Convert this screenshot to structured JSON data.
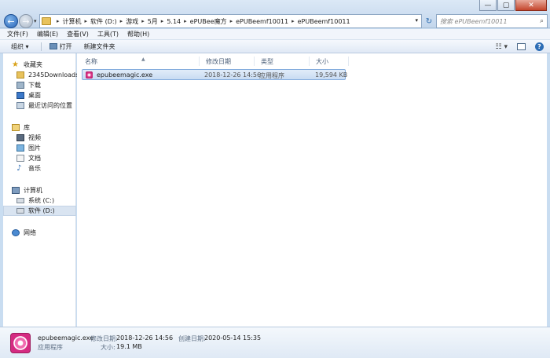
{
  "window": {
    "minimize": "—",
    "maximize": "▢",
    "close": "✕"
  },
  "nav": {
    "back_glyph": "←",
    "forward_glyph": "→"
  },
  "address": {
    "crumbs": [
      "计算机",
      "软件 (D:)",
      "游戏",
      "5月",
      "5.14",
      "ePUBee魔方",
      "ePUBeemf10011",
      "ePUBeemf10011"
    ]
  },
  "search": {
    "placeholder": "搜索 ePUBeemf10011"
  },
  "menu": {
    "items": [
      "文件(F)",
      "编辑(E)",
      "查看(V)",
      "工具(T)",
      "帮助(H)"
    ]
  },
  "toolbar": {
    "organize": "组织 ▾",
    "open": "打开",
    "new_folder": "新建文件夹"
  },
  "sidebar": {
    "favorites": "收藏夹",
    "fav_items": [
      "2345Downloads",
      "下载",
      "桌面",
      "最近访问的位置"
    ],
    "library": "库",
    "lib_items": [
      "视频",
      "图片",
      "文档",
      "音乐"
    ],
    "computer": "计算机",
    "drives": [
      "系统 (C:)",
      "软件 (D:)"
    ],
    "network": "网络"
  },
  "columns": {
    "name": "名称",
    "modified": "修改日期",
    "type": "类型",
    "size": "大小"
  },
  "files": [
    {
      "name": "epubeemagic.exe",
      "modified": "2018-12-26 14:56",
      "type": "应用程序",
      "size": "19,594 KB"
    }
  ],
  "details": {
    "filename": "epubeemagic.exe",
    "filetype": "应用程序",
    "modified_label": "修改日期:",
    "modified_value": "2018-12-26 14:56",
    "created_label": "创建日期:",
    "created_value": "2020-05-14 15:35",
    "size_label": "大小:",
    "size_value": "19.1 MB"
  }
}
